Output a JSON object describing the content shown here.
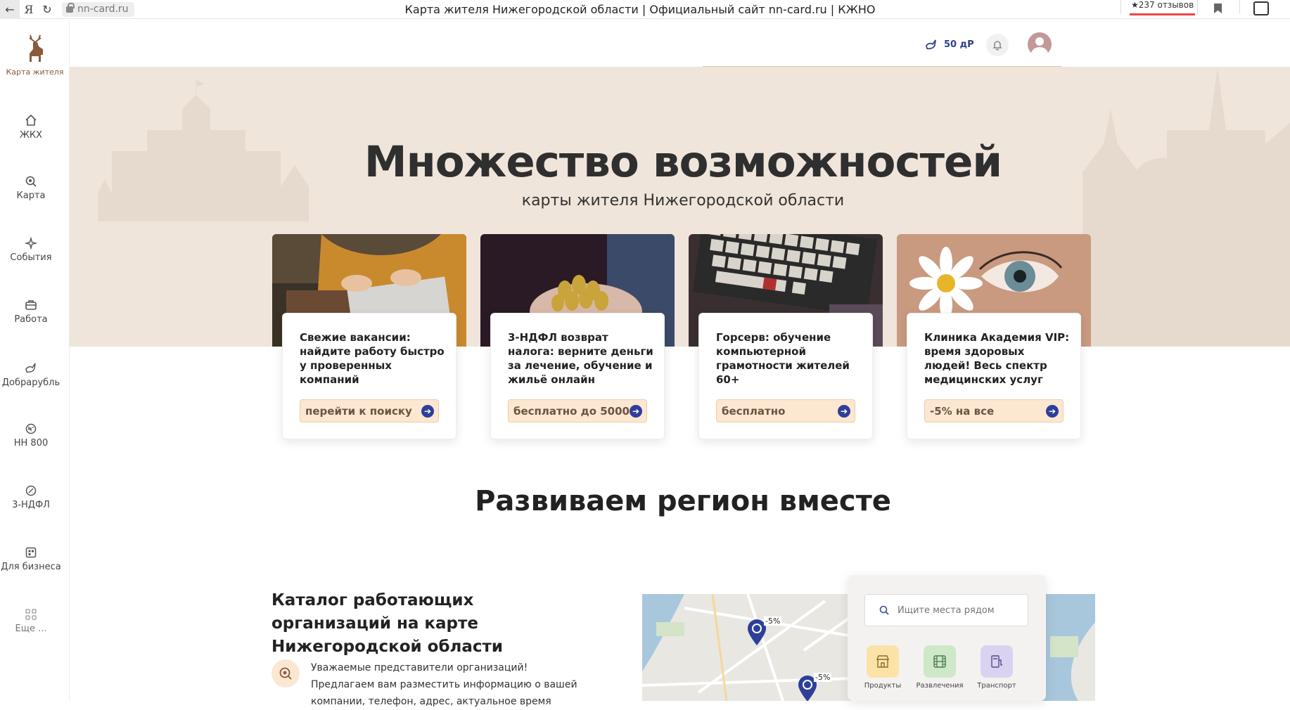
{
  "browser": {
    "url": "nn-card.ru",
    "title": "Карта жителя Нижегородской области | Официальный сайт nn-card.ru | КЖНО",
    "reviews": "★237 отзывов"
  },
  "sidebar": {
    "logo_label": "Карта жителя",
    "items": [
      {
        "label": "ЖКХ",
        "icon": "house-icon"
      },
      {
        "label": "Карта",
        "icon": "map-search-icon"
      },
      {
        "label": "События",
        "icon": "sparkle-icon"
      },
      {
        "label": "Работа",
        "icon": "briefcase-icon"
      },
      {
        "label": "Добрарубль",
        "icon": "dove-icon"
      },
      {
        "label": "НН 800",
        "icon": "nn800-icon"
      },
      {
        "label": "3-НДФЛ",
        "icon": "tax-icon"
      },
      {
        "label": "Для бизнеса",
        "icon": "business-icon"
      },
      {
        "label": "Еще ...",
        "icon": "grid-icon"
      }
    ]
  },
  "header": {
    "dobro_value": "50 дР"
  },
  "hero": {
    "title": "Множество возможностей",
    "subtitle": "карты жителя Нижегородской области"
  },
  "cards": [
    {
      "title": "Свежие вакансии: найдите работу быстро у проверенных компаний",
      "button": "перейти к поиску"
    },
    {
      "title": "3-НДФЛ возврат налога: верните деньги за лечение, обучение и жильё онлайн",
      "button": "бесплатно до 5000 ₽"
    },
    {
      "title": "Горсерв: обучение компьютерной грамотности жителей 60+",
      "button": "бесплатно"
    },
    {
      "title": "Клиника Академия VIP: время здоровых людей! Весь спектр медицинских услуг",
      "button": "-5% на все"
    }
  ],
  "region": {
    "title": "Развиваем регион вместе"
  },
  "catalog": {
    "title": "Каталог работающих организаций на карте Нижегородской области",
    "text": "Уважаемые представители организаций! Предлагаем вам разместить информацию о вашей компании, телефон, адрес, актуальное время"
  },
  "map": {
    "search_placeholder": "Ищите места рядом",
    "pin_discount": "-5%",
    "categories": [
      {
        "label": "Продукты",
        "color": "#fbe3a8"
      },
      {
        "label": "Развлечения",
        "color": "#cfe8c8"
      },
      {
        "label": "Транспорт",
        "color": "#d9d3f0"
      }
    ]
  },
  "colors": {
    "accent_blue": "#2e3f99",
    "hero_bg": "#efe5da",
    "button_bg": "#fbe7d2"
  }
}
